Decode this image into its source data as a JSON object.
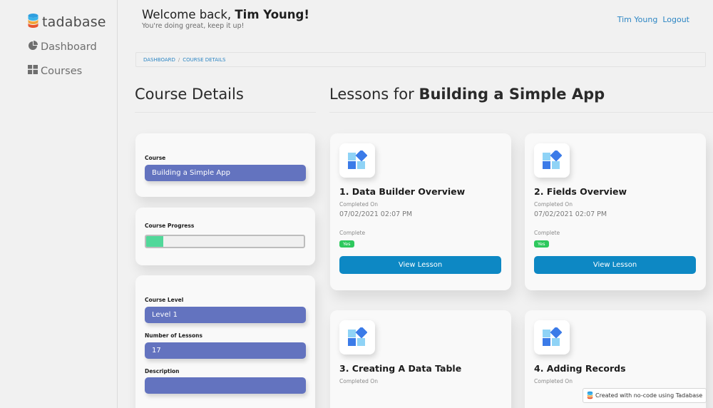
{
  "brand": {
    "name": "tadabase"
  },
  "sidebar": {
    "items": [
      {
        "label": "Dashboard",
        "icon": "pie-chart-icon"
      },
      {
        "label": "Courses",
        "icon": "grid-icon"
      }
    ]
  },
  "header": {
    "welcome_prefix": "Welcome back, ",
    "user_name": "Tim Young!",
    "subtitle": "You're doing great, keep it up!",
    "user_link": "Tim Young",
    "logout_link": "Logout"
  },
  "breadcrumb": {
    "items": [
      "DASHBOARD",
      "COURSE DETAILS"
    ],
    "separator": "/"
  },
  "course_details": {
    "heading": "Course Details",
    "course_label": "Course",
    "course_value": "Building a Simple App",
    "progress_label": "Course Progress",
    "progress_fraction": 0.11,
    "level_label": "Course Level",
    "level_value": "Level 1",
    "lessons_label": "Number of Lessons",
    "lessons_value": "17",
    "description_label": "Description",
    "description_value": ""
  },
  "lessons": {
    "heading_prefix": "Lessons for ",
    "heading_course": "Building a Simple App",
    "cards": [
      {
        "title": "1. Data Builder Overview",
        "completed_on_label": "Completed On",
        "completed_on": "07/02/2021 02:07 PM",
        "complete_label": "Complete",
        "complete_value": "Yes",
        "button": "View Lesson"
      },
      {
        "title": "2. Fields Overview",
        "completed_on_label": "Completed On",
        "completed_on": "07/02/2021 02:07 PM",
        "complete_label": "Complete",
        "complete_value": "Yes",
        "button": "View Lesson"
      },
      {
        "title": "3. Creating A Data Table",
        "completed_on_label": "Completed On"
      },
      {
        "title": "4. Adding Records",
        "completed_on_label": "Completed On"
      }
    ]
  },
  "footer": {
    "badge_text": "Created with no-code using Tadabase"
  },
  "colors": {
    "field_bg": "#6373bf",
    "button_bg": "#0d88c4",
    "progress_fill": "#51d89a",
    "badge_green": "#2ec85d",
    "link_blue": "#2d86c4"
  }
}
